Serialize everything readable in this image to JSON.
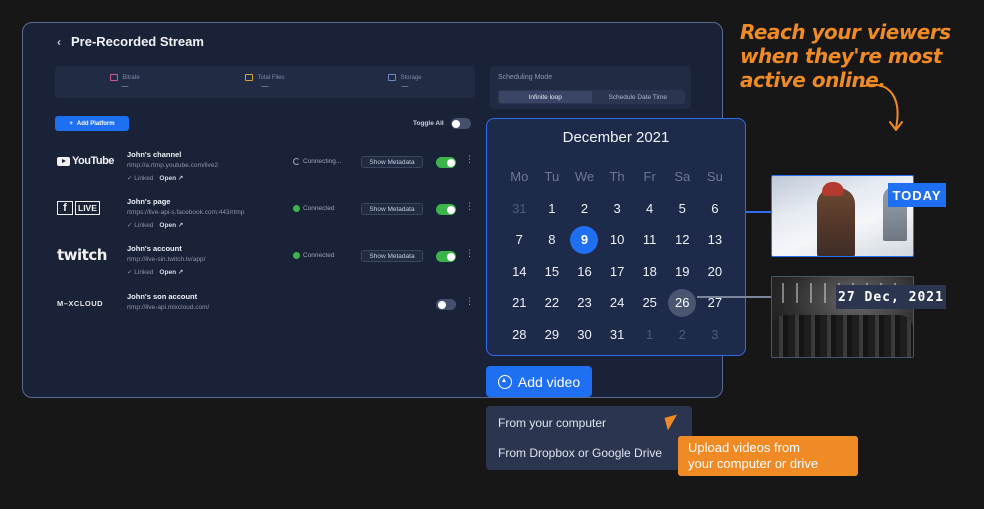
{
  "panel": {
    "back_icon": "‹",
    "title": "Pre-Recorded Stream",
    "stats": [
      {
        "label": "Bitrate",
        "value": "—",
        "icon": "bitrate-icon"
      },
      {
        "label": "Total Files",
        "value": "—",
        "icon": "files-icon"
      },
      {
        "label": "Storage",
        "value": "—",
        "icon": "storage-icon"
      }
    ],
    "scheduling": {
      "label": "Scheduling Mode",
      "tabs": [
        "Infinite loop",
        "Schedule Date Time"
      ],
      "active_tab": "Infinite loop"
    },
    "add_platform_label": "Add Platform",
    "add_platform_plus": "+",
    "toggle_all_label": "Toggle All",
    "platforms": [
      {
        "logo": "YouTube",
        "name": "John's channel",
        "url": "rtmp://a.rtmp.youtube.com/live2",
        "linked": "Linked",
        "open": "Open",
        "status": "Connecting...",
        "meta_btn": "Show Metadata",
        "enabled": true
      },
      {
        "logo_f": "f",
        "logo_live": "LIVE",
        "name": "John's page",
        "url": "rtmps://live-api-s.facebook.com:443/rtmp",
        "linked": "Linked",
        "open": "Open",
        "status": "Connected",
        "meta_btn": "Show Metadata",
        "enabled": true
      },
      {
        "logo": "twitch",
        "name": "John's account",
        "url": "rtmp://live-sin.twitch.tv/app/",
        "linked": "Linked",
        "open": "Open",
        "status": "Connected",
        "meta_btn": "Show Metadata",
        "enabled": true
      },
      {
        "logo": "M–XCLOUD",
        "name": "John's son account",
        "url": "rtmp://live-api.mixcloud.com/",
        "enabled": false
      }
    ],
    "kebab": "⋮"
  },
  "calendar": {
    "title": "December 2021",
    "weekdays": [
      "Mo",
      "Tu",
      "We",
      "Th",
      "Fr",
      "Sa",
      "Su"
    ],
    "days": [
      "31",
      "1",
      "2",
      "3",
      "4",
      "5",
      "6",
      "7",
      "8",
      "9",
      "10",
      "11",
      "12",
      "13",
      "14",
      "15",
      "16",
      "17",
      "18",
      "19",
      "20",
      "21",
      "22",
      "23",
      "24",
      "25",
      "26",
      "27",
      "28",
      "29",
      "30",
      "31",
      "1",
      "2",
      "3"
    ],
    "today": "9",
    "selected": "26"
  },
  "add_video": {
    "label": "Add video",
    "options": [
      "From your computer",
      "From Dropbox or Google Drive"
    ]
  },
  "callouts": {
    "top": [
      "Reach your viewers",
      "when they're most",
      "active online."
    ],
    "bottom": [
      "Upload videos from",
      "your computer or drive"
    ]
  },
  "tags": {
    "today": "TODAY",
    "date": "27 Dec, 2021"
  },
  "colors": {
    "accent": "#1f6ff2",
    "highlight": "#f08a24",
    "success": "#3bb54a",
    "panel_bg": "#1a2238"
  }
}
